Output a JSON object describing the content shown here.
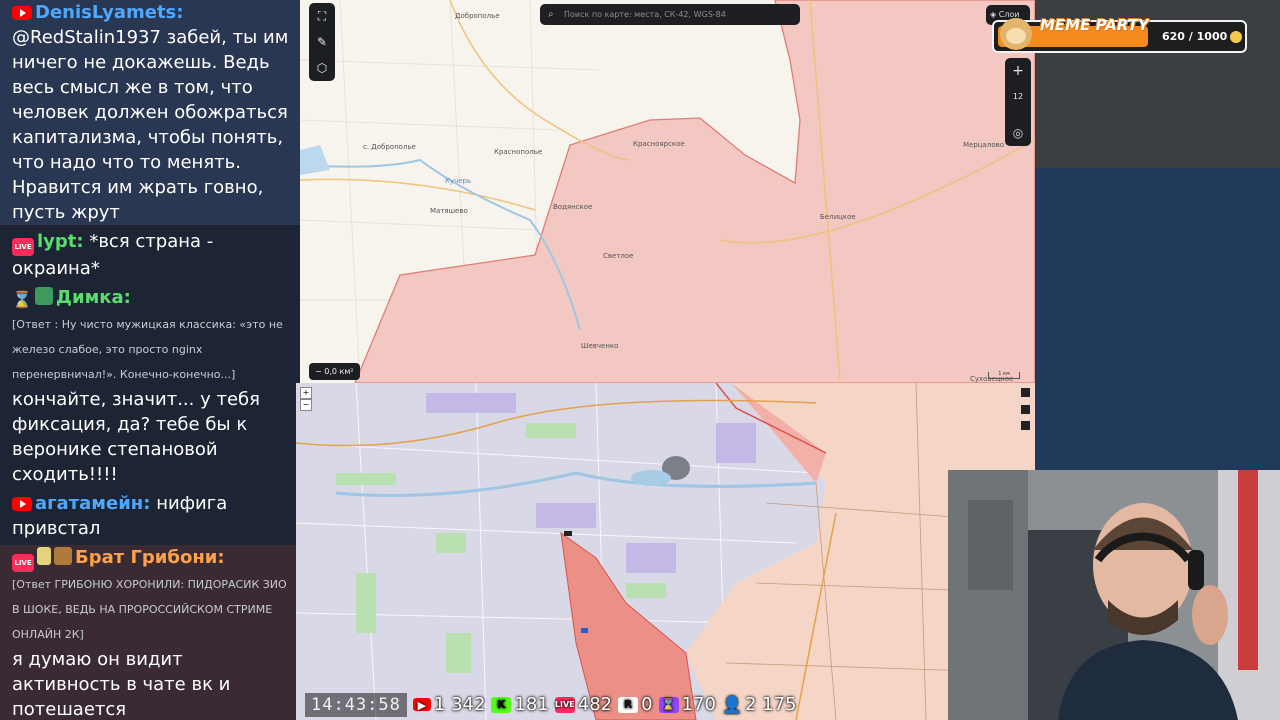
{
  "chat": {
    "messages": [
      {
        "badges": [
          "youtube"
        ],
        "author": "DenisLyamets:",
        "author_color": "#4fa8ff",
        "text": "@RedStalin1937 забей, ты им ничего не докажешь. Ведь весь смысл же в том, что человек должен обожраться капитализма, чтобы понять, что надо что то менять. Нравится им жрать говно, пусть жрут",
        "highlight": "blue"
      },
      {
        "badges": [
          "live"
        ],
        "author": "lypt:",
        "author_color": "#5bdc6e",
        "text": "*вся страна - окраина*"
      },
      {
        "badges": [
          "twitch",
          "money"
        ],
        "author": "Димка:",
        "author_color": "#5bdc6e",
        "reply": "[Ответ : Ну чисто мужицкая классика: «это не железо слабое, это просто nginx перенервничал!». Конечно-конечно...]",
        "text": "кончайте, значит... у тебя фиксация, да? тебе бы к веронике степановой сходить!!!!"
      },
      {
        "badges": [
          "youtube"
        ],
        "author": "агатамейн:",
        "author_color": "#4fa8ff",
        "text": "нифига привстал"
      },
      {
        "badges": [
          "live",
          "cup",
          "cake"
        ],
        "author": "Брат Грибони:",
        "author_color": "#ffa24a",
        "reply": "[Ответ ГРИБОНЮ ХОРОНИЛИ: ПИДОРАСИК ЗИО В ШОКЕ, ВЕДЬ НА ПРОРОССИЙСКОМ СТРИМЕ ОНЛАЙН 2К]",
        "text": "я думаю он видит активность в чате вк и потешается",
        "highlight": "red"
      }
    ]
  },
  "map_top": {
    "search_placeholder": "Поиск по карте: места, СК-42, WGS-84",
    "zoom_level": "12",
    "area_chip": "0,0 км²",
    "layers_label": "Слои",
    "scale_label": "1 км",
    "places": [
      {
        "name": "Доброполье",
        "key": "dobropolye"
      },
      {
        "name": "с. Доброполье",
        "key": "s_dobropolye"
      },
      {
        "name": "Краснополье",
        "key": "krasnopolye"
      },
      {
        "name": "Красноярское",
        "key": "krasnoyarskoe"
      },
      {
        "name": "Водянское",
        "key": "vodyanskoe"
      },
      {
        "name": "Матяшево",
        "key": "matyashevo"
      },
      {
        "name": "Светлое",
        "key": "svetloe"
      },
      {
        "name": "Белицкое",
        "key": "belitskoe"
      },
      {
        "name": "Мерцалово",
        "key": "mertsalovo"
      },
      {
        "name": "Шевченко",
        "key": "shevchenko"
      },
      {
        "name": "Кучерь",
        "key": "kucher"
      },
      {
        "name": "Суховецкое",
        "key": "sukhovetskoe"
      }
    ]
  },
  "widget": {
    "title": "MEME PARTY",
    "score": "620 / 1000"
  },
  "stats": {
    "clock": "14:43:58",
    "youtube": "1 342",
    "kick": "181",
    "live": "482",
    "rutube": "0",
    "twitch": "170",
    "users": "2 175"
  },
  "colors": {
    "occupied": "#f3b5b1",
    "occupied_border": "#d9534f",
    "chat_bg": "#1d2535"
  }
}
